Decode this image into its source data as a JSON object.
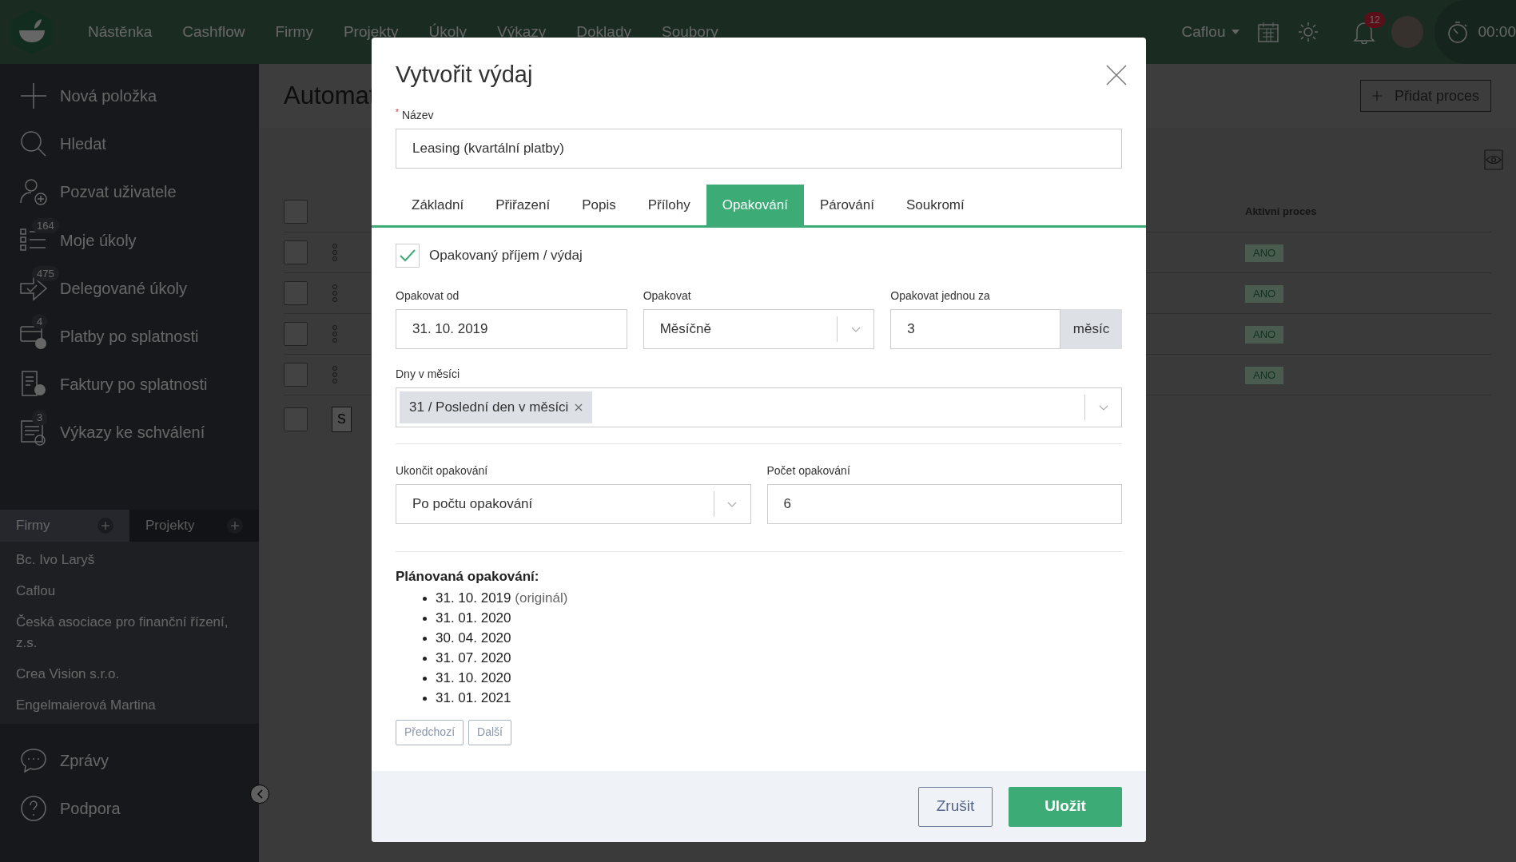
{
  "topbar": {
    "nav": [
      "Nástěnka",
      "Cashflow",
      "Firmy",
      "Projekty",
      "Úkoly",
      "Výkazy",
      "Doklady",
      "Soubory"
    ],
    "account": "Caflou",
    "notification_count": "12",
    "timer": "00:00"
  },
  "sidebar": {
    "actions": [
      {
        "kind": "plus",
        "label": "Nová položka"
      },
      {
        "kind": "search",
        "label": "Hledat"
      },
      {
        "kind": "invite",
        "label": "Pozvat uživatele"
      },
      {
        "kind": "tasks",
        "label": "Moje úkoly",
        "badge": "164"
      },
      {
        "kind": "delegated",
        "label": "Delegované úkoly",
        "badge": "475"
      },
      {
        "kind": "payments",
        "label": "Platby po splatnosti",
        "badge": "4"
      },
      {
        "kind": "invoices",
        "label": "Faktury po splatnosti"
      },
      {
        "kind": "reports",
        "label": "Výkazy ke schválení",
        "badge": "3"
      }
    ],
    "tabs": [
      {
        "label": "Firmy",
        "selected": true
      },
      {
        "label": "Projekty",
        "selected": false
      }
    ],
    "companies": [
      "Bc. Ivo Laryš",
      "Caflou",
      "Česká asociace pro finanční řízení, z.s.",
      "Crea Vision s.r.o.",
      "Engelmaierová Martina"
    ],
    "bottom": [
      {
        "kind": "messages",
        "label": "Zprávy"
      },
      {
        "kind": "help",
        "label": "Podpora"
      }
    ]
  },
  "page": {
    "title": "Automat",
    "add_button": "Přidat proces",
    "column": "Aktivní proces",
    "header_checked": false,
    "rows": [
      {
        "checked": false,
        "active": "ANO"
      },
      {
        "checked": false,
        "active": "ANO"
      },
      {
        "checked": false,
        "active": "ANO"
      },
      {
        "checked": false,
        "active": "ANO"
      }
    ],
    "footer_checked": false,
    "partial_button": "S"
  },
  "modal": {
    "title": "Vytvořit výdaj",
    "name": {
      "required_mark": "*",
      "label": "Název",
      "value": "Leasing (kvartální platby)"
    },
    "tabs": [
      {
        "label": "Základní",
        "selected": false
      },
      {
        "label": "Přiřazení",
        "selected": false
      },
      {
        "label": "Popis",
        "selected": false
      },
      {
        "label": "Přílohy",
        "selected": false
      },
      {
        "label": "Opakování",
        "selected": true
      },
      {
        "label": "Párování",
        "selected": false
      },
      {
        "label": "Soukromí",
        "selected": false
      }
    ],
    "recurring": {
      "label": "Opakovaný příjem / výdaj",
      "checked": true
    },
    "repeat_from": {
      "label": "Opakovat od",
      "value": "31. 10. 2019"
    },
    "repeat": {
      "label": "Opakovat",
      "value": "Měsíčně"
    },
    "repeat_every": {
      "label": "Opakovat jednou za",
      "value": "3",
      "unit": "měsíc"
    },
    "days_in_month": {
      "label": "Dny v měsíci",
      "tags": [
        "31 / Poslední den v měsíci"
      ]
    },
    "end_repeat": {
      "label": "Ukončit opakování",
      "value": "Po počtu opakování"
    },
    "count": {
      "label": "Počet opakování",
      "value": "6"
    },
    "planned": {
      "title": "Plánovaná opakování:",
      "items": [
        {
          "date": "31. 10. 2019",
          "note": "(originál)"
        },
        {
          "date": "31. 01. 2020"
        },
        {
          "date": "30. 04. 2020"
        },
        {
          "date": "31. 07. 2020"
        },
        {
          "date": "31. 10. 2020"
        },
        {
          "date": "31. 01. 2021"
        }
      ]
    },
    "pager": [
      "Předchozí",
      "Další"
    ],
    "cancel": "Zrušit",
    "save": "Uložit"
  }
}
